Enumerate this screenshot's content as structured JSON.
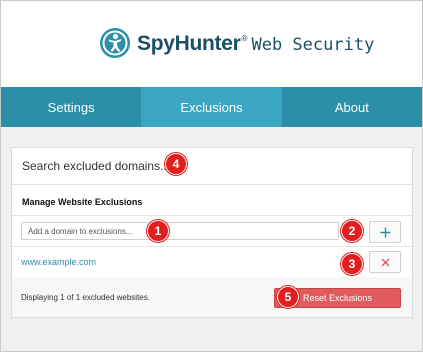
{
  "header": {
    "brand_name": "SpyHunter",
    "brand_mark": "®",
    "product": "Web Security",
    "logo_icon": "spyhunter-figure-logo"
  },
  "nav": {
    "tabs": [
      {
        "label": "Settings",
        "active": false
      },
      {
        "label": "Exclusions",
        "active": true
      },
      {
        "label": "About",
        "active": false
      }
    ]
  },
  "search": {
    "placeholder": "Search excluded domains..."
  },
  "manage": {
    "title": "Manage Website Exclusions",
    "add_placeholder": "Add a domain to exclusions...",
    "add_icon": "plus-icon",
    "remove_icon": "close-icon"
  },
  "exclusions": [
    {
      "domain": "www.example.com"
    }
  ],
  "footer": {
    "status": "Displaying 1 of 1 excluded websites.",
    "reset_label": "Reset Exclusions"
  },
  "markers": {
    "add_input": "1",
    "add_button": "2",
    "remove_button": "3",
    "search": "4",
    "reset": "5"
  },
  "colors": {
    "nav": "#2b8fa8",
    "nav_active": "#3aa6c1",
    "link": "#2b8fa8",
    "reset": "#e05a5e",
    "marker": "#e11f1f",
    "brand": "#1a4f66"
  }
}
